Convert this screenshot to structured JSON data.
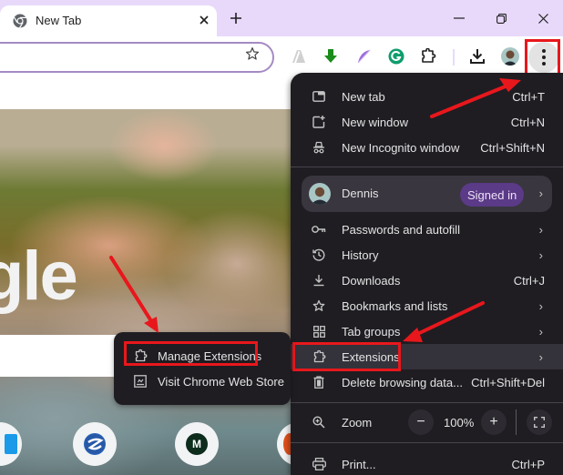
{
  "browser": {
    "tab": {
      "title": "New Tab",
      "favicon": "chrome-icon",
      "close_icon": "close-icon"
    },
    "new_tab_icon": "plus-icon",
    "window_controls": [
      "minimize-icon",
      "restore-icon",
      "close-icon"
    ],
    "toolbar": {
      "omnibox_value": "",
      "bookmark_icon": "star-icon",
      "extensions": [
        "ai-extension-icon",
        "download-arrow-extension-icon",
        "feather-extension-icon",
        "grammarly-icon",
        "puzzle-piece-icon"
      ],
      "downloads_icon": "download-icon",
      "profile_icon": "profile-avatar",
      "menu_icon": "three-dot-menu-icon"
    }
  },
  "new_tab_page": {
    "logo_text": "gle",
    "shortcuts": [
      {
        "icon": "shortcut-blue-square-icon",
        "label": ""
      },
      {
        "icon": "shortcut-globe-icon",
        "label": ""
      },
      {
        "icon": "shortcut-m-icon",
        "glyph": "M",
        "label": ""
      },
      {
        "icon": "shortcut-orange-icon",
        "label": ""
      }
    ]
  },
  "menu": {
    "sections": [
      {
        "items": [
          {
            "id": "new-tab",
            "icon": "new-tab-icon",
            "label": "New tab",
            "shortcut": "Ctrl+T"
          },
          {
            "id": "new-window",
            "icon": "new-window-icon",
            "label": "New window",
            "shortcut": "Ctrl+N"
          },
          {
            "id": "new-incognito",
            "icon": "incognito-icon",
            "label": "New Incognito window",
            "shortcut": "Ctrl+Shift+N"
          }
        ]
      }
    ],
    "profile": {
      "name": "Dennis",
      "status": "Signed in"
    },
    "items": [
      {
        "id": "passwords",
        "icon": "key-icon",
        "label": "Passwords and autofill",
        "submenu": true
      },
      {
        "id": "history",
        "icon": "history-icon",
        "label": "History",
        "submenu": true
      },
      {
        "id": "downloads",
        "icon": "download-icon",
        "label": "Downloads",
        "shortcut": "Ctrl+J"
      },
      {
        "id": "bookmarks",
        "icon": "star-icon",
        "label": "Bookmarks and lists",
        "submenu": true
      },
      {
        "id": "tab-groups",
        "icon": "tab-groups-icon",
        "label": "Tab groups",
        "submenu": true
      },
      {
        "id": "extensions",
        "icon": "puzzle-piece-icon",
        "label": "Extensions",
        "submenu": true,
        "highlighted": true
      },
      {
        "id": "delete-browsing-data",
        "icon": "trash-icon",
        "label": "Delete browsing data...",
        "shortcut": "Ctrl+Shift+Del"
      }
    ],
    "zoom": {
      "label": "Zoom",
      "value": "100%",
      "minus": "−",
      "plus": "+"
    },
    "print": {
      "label": "Print...",
      "shortcut": "Ctrl+P"
    }
  },
  "extensions_submenu": {
    "items": [
      {
        "id": "manage-extensions",
        "icon": "puzzle-piece-icon",
        "label": "Manage Extensions",
        "highlighted": true
      },
      {
        "id": "chrome-web-store",
        "icon": "web-store-icon",
        "label": "Visit Chrome Web Store"
      }
    ]
  },
  "colors": {
    "titlebar": "#e8d9fb",
    "menu_bg": "#1f1d22",
    "menu_hover": "#34323a",
    "signed_in_badge": "#5b3a87",
    "annotation_red": "#e8171c",
    "omnibox_border": "#a58ac4"
  }
}
